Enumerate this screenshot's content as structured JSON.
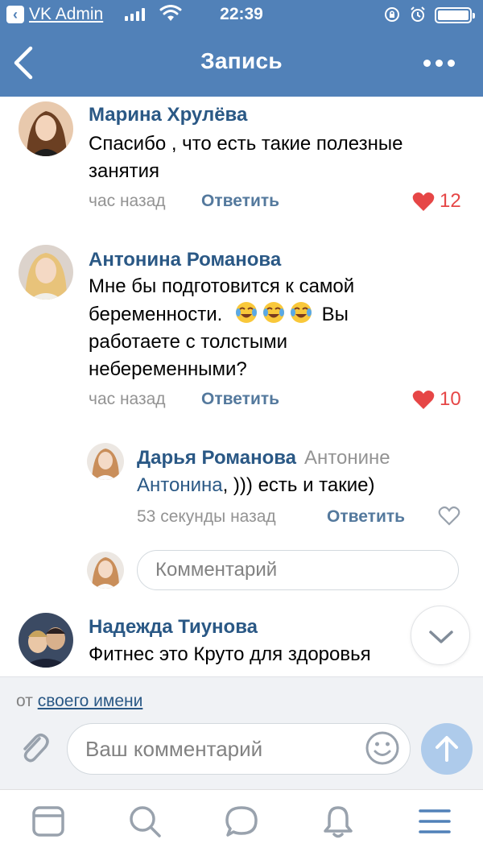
{
  "status_bar": {
    "back_app": "VK Admin",
    "time": "22:39"
  },
  "nav": {
    "title": "Запись",
    "back_icon": "chevron-left-icon",
    "more_icon": "more-dots-icon"
  },
  "comments": [
    {
      "author": "Марина Хрулёва",
      "text_lines": [
        "Спасибо , что есть такие полезные",
        "занятия"
      ],
      "time": "час назад",
      "reply": "Ответить",
      "likes": "12",
      "liked": true
    },
    {
      "author": "Антонина Романова",
      "text_lines": [
        "Мне бы подготовится к самой",
        "беременности.",
        "Вы",
        "работаете с толстыми",
        "небеременными?"
      ],
      "emoji": "tears-of-joy-emoji",
      "time": "час назад",
      "reply": "Ответить",
      "likes": "10",
      "liked": true
    },
    {
      "author": "Дарья Романова",
      "reply_to": "Антонине",
      "reply_to_name": "Антонина",
      "text": ", ))) есть и такие)",
      "time": "53 секунды назад",
      "reply": "Ответить"
    },
    {
      "author": "Надежда Тиунова",
      "text": "Фитнес это Круто для здоровья"
    }
  ],
  "reply_input": {
    "placeholder": "Комментарий"
  },
  "composer": {
    "from_prefix": "от",
    "from_link": "своего имени",
    "placeholder": "Ваш комментарий"
  },
  "tabs": [
    "news-icon",
    "search-icon",
    "messages-icon",
    "notifications-icon",
    "menu-icon"
  ],
  "colors": {
    "header": "#5181b8",
    "link": "#2a5885",
    "like": "#e64646",
    "send": "#aecbeb"
  }
}
